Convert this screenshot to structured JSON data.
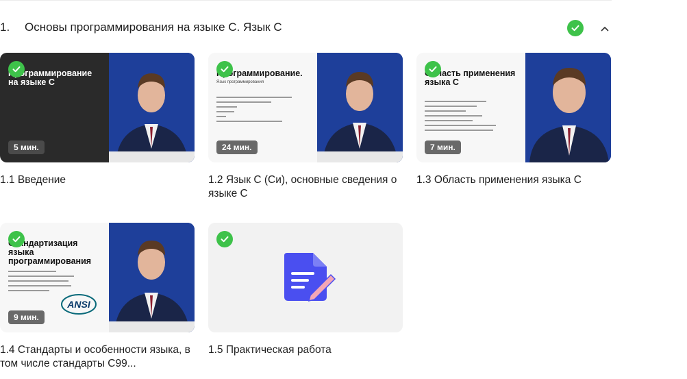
{
  "section": {
    "number": "1.",
    "title": "Основы программирования на языке С. Язык С",
    "completed": true
  },
  "colors": {
    "check": "#3ec24a",
    "video_bg": "#1e3f9a",
    "practical_bg": "#f2f2f2",
    "doc_icon": "#4a4ff0"
  },
  "lessons": [
    {
      "title": "1.1 Введение",
      "duration": "5 мин.",
      "slide_title": "Программирование на языке С",
      "slide_theme": "dark",
      "completed": true
    },
    {
      "title": "1.2 Язык С (Си), основные сведения о языке С",
      "duration": "24 мин.",
      "slide_title": "Программирование.",
      "slide_subtitle": "Язык программирования",
      "slide_theme": "light",
      "completed": true
    },
    {
      "title": "1.3 Область применения языка С",
      "duration": "7 мин.",
      "slide_title": "Область применения языка С",
      "slide_theme": "light",
      "completed": true
    },
    {
      "title": "1.4 Стандарты и особенности языка, в том числе стандарты С99...",
      "duration": "9 мин.",
      "slide_title": "Стандартизация языка программирования",
      "slide_theme": "light",
      "logo_text": "ANSI",
      "completed": true
    },
    {
      "title": "1.5 Практическая работа",
      "icon": "document-edit-icon",
      "completed": true
    }
  ]
}
